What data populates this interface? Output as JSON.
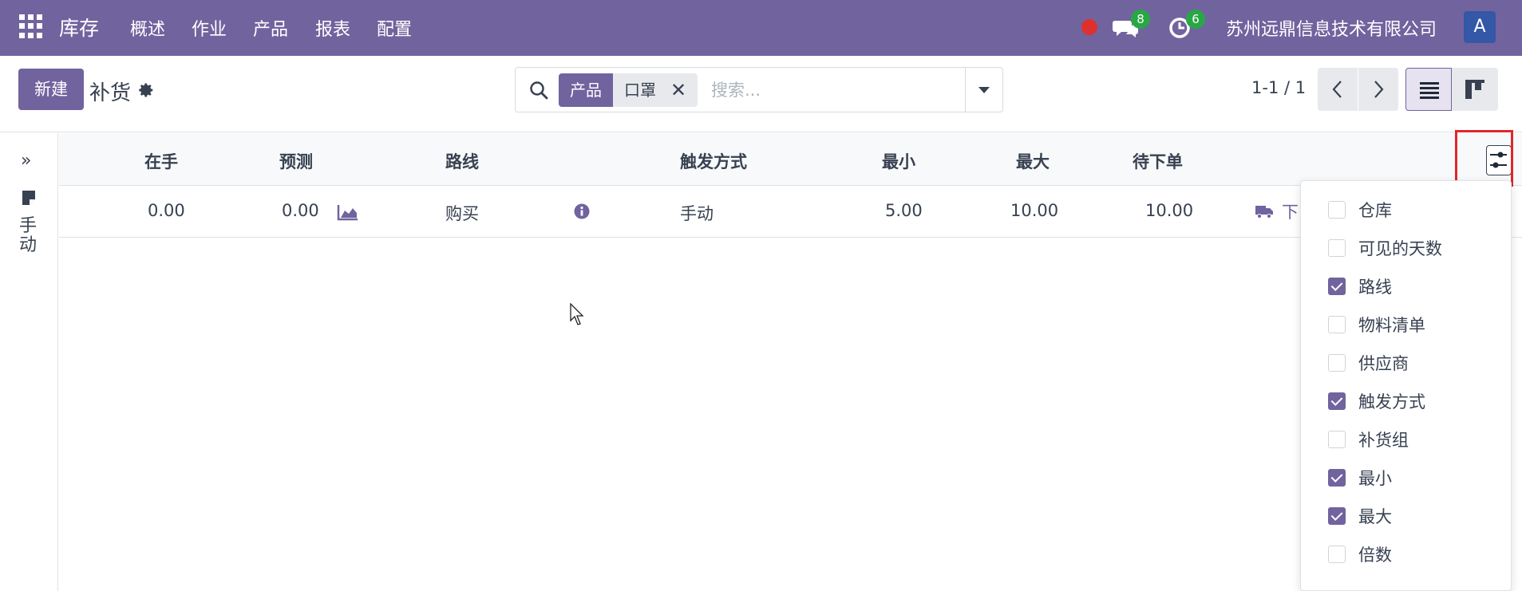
{
  "navbar": {
    "brand": "库存",
    "menu": [
      "概述",
      "作业",
      "产品",
      "报表",
      "配置"
    ],
    "messages_count": "8",
    "activities_count": "6",
    "company": "苏州远鼎信息技术有限公司",
    "avatar_letter": "A",
    "accent_color": "#71639e"
  },
  "control_panel": {
    "new_button": "新建",
    "title": "补货",
    "search": {
      "facet_label": "产品",
      "facet_value": "口罩",
      "placeholder": "搜索..."
    },
    "pager": "1-1 / 1"
  },
  "side_panel": {
    "filter_label": "手动"
  },
  "table": {
    "headers": {
      "on_hand": "在手",
      "forecast": "预测",
      "route": "路线",
      "trigger": "触发方式",
      "min": "最小",
      "max": "最大",
      "to_order": "待下单"
    },
    "rows": [
      {
        "on_hand": "0.00",
        "forecast": "0.00",
        "route": "购买",
        "trigger": "手动",
        "min": "5.00",
        "max": "10.00",
        "to_order": "10.00",
        "order_label": "下"
      }
    ]
  },
  "optional_columns": [
    {
      "label": "仓库",
      "checked": false
    },
    {
      "label": "可见的天数",
      "checked": false
    },
    {
      "label": "路线",
      "checked": true
    },
    {
      "label": "物料清单",
      "checked": false
    },
    {
      "label": "供应商",
      "checked": false
    },
    {
      "label": "触发方式",
      "checked": true
    },
    {
      "label": "补货组",
      "checked": false
    },
    {
      "label": "最小",
      "checked": true
    },
    {
      "label": "最大",
      "checked": true
    },
    {
      "label": "倍数",
      "checked": false
    }
  ]
}
